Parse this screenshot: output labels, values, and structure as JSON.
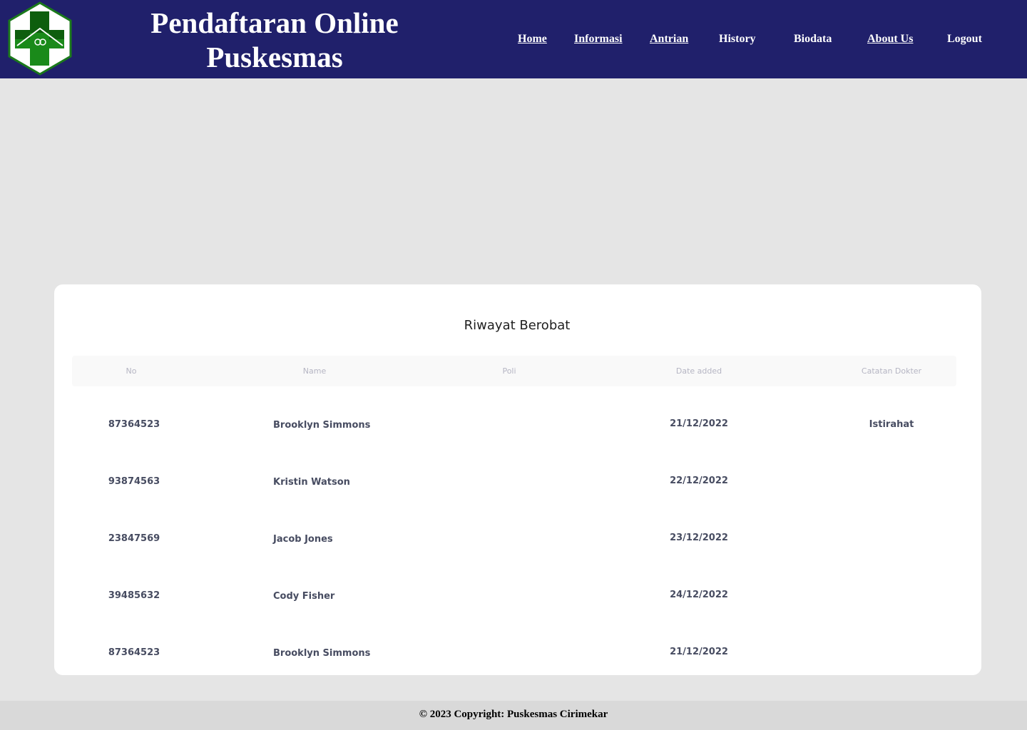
{
  "header": {
    "title_line1": "Pendaftaran Online",
    "title_line2": "Puskesmas",
    "background": "#20206b",
    "logo_icon": "puskesmas-logo"
  },
  "nav": {
    "items": [
      {
        "label": "Home",
        "underlined": true
      },
      {
        "label": "Informasi",
        "underlined": true
      },
      {
        "label": "Antrian",
        "underlined": true
      },
      {
        "label": "History",
        "underlined": false
      },
      {
        "label": "Biodata",
        "underlined": false
      },
      {
        "label": "About Us",
        "underlined": true
      },
      {
        "label": "Logout",
        "underlined": false
      }
    ]
  },
  "history": {
    "title": "Riwayat Berobat",
    "columns": [
      "No",
      "Name",
      "Poli",
      "Date added",
      "Catatan Dokter"
    ],
    "rows": [
      {
        "no": "87364523",
        "name": "Brooklyn Simmons",
        "poli": "",
        "date": "21/12/2022",
        "catatan": "Istirahat"
      },
      {
        "no": "93874563",
        "name": "Kristin Watson",
        "poli": "",
        "date": "22/12/2022",
        "catatan": ""
      },
      {
        "no": "23847569",
        "name": "Jacob Jones",
        "poli": "",
        "date": "23/12/2022",
        "catatan": ""
      },
      {
        "no": "39485632",
        "name": "Cody Fisher",
        "poli": "",
        "date": "24/12/2022",
        "catatan": ""
      },
      {
        "no": "87364523",
        "name": "Brooklyn Simmons",
        "poli": "",
        "date": "21/12/2022",
        "catatan": ""
      }
    ]
  },
  "footer": {
    "text": "© 2023 Copyright: Puskesmas Cirimekar"
  }
}
